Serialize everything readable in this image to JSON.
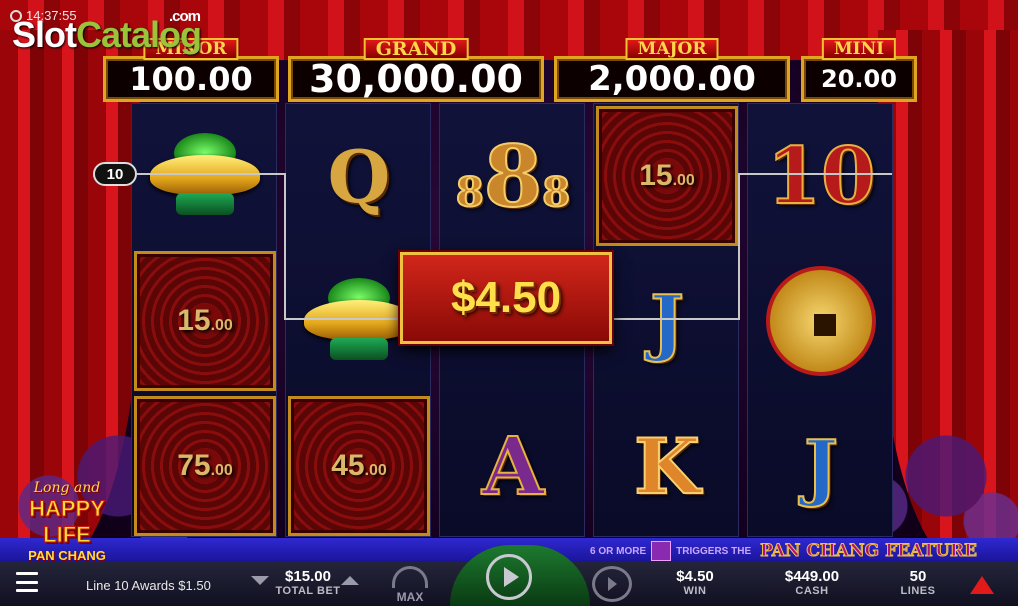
{
  "status": {
    "time": "14:37:55"
  },
  "watermark": {
    "part1": "Slot",
    "part2": "Catalog",
    "suffix": ".com"
  },
  "jackpots": [
    {
      "label": "MINOR",
      "value": "100.00"
    },
    {
      "label": "GRAND",
      "value": "30,000.00"
    },
    {
      "label": "MAJOR",
      "value": "2,000.00"
    },
    {
      "label": "MINI",
      "value": "20.00"
    }
  ],
  "payline_badge": "10",
  "reels": [
    [
      {
        "type": "ingot"
      },
      {
        "type": "value",
        "value": "15",
        "cents": ".00"
      },
      {
        "type": "value",
        "value": "75",
        "cents": ".00"
      }
    ],
    [
      {
        "type": "letter",
        "text": "Q"
      },
      {
        "type": "ingot"
      },
      {
        "type": "value",
        "value": "45",
        "cents": ".00"
      }
    ],
    [
      {
        "type": "eight",
        "text": "8"
      },
      {
        "type": "hidden"
      },
      {
        "type": "letter",
        "text": "A"
      }
    ],
    [
      {
        "type": "value",
        "value": "15",
        "cents": ".00"
      },
      {
        "type": "letter",
        "text": "J"
      },
      {
        "type": "letter",
        "text": "K"
      }
    ],
    [
      {
        "type": "letter",
        "text": "10"
      },
      {
        "type": "coin"
      },
      {
        "type": "letter",
        "text": "J"
      }
    ]
  ],
  "win_banner": "$4.50",
  "game_logo": {
    "top": "Long and",
    "middle": "HAPPY LIFE",
    "bottom": "PAN CHANG"
  },
  "feature_hint": {
    "prefix": "6 OR MORE",
    "middle": "TRIGGERS THE",
    "feature": "PAN CHANG FEATURE"
  },
  "bottom_bar": {
    "message": "Line 10 Awards $1.50",
    "total_bet": {
      "value": "$15.00",
      "label": "TOTAL BET"
    },
    "max_label": "MAX",
    "win": {
      "value": "$4.50",
      "label": "WIN"
    },
    "cash": {
      "value": "$449.00",
      "label": "CASH"
    },
    "lines": {
      "value": "50",
      "label": "LINES"
    }
  },
  "colors": {
    "accent_gold": "#f0c040",
    "curtain_red": "#d2121a",
    "stage_blue": "#2f28d0"
  }
}
